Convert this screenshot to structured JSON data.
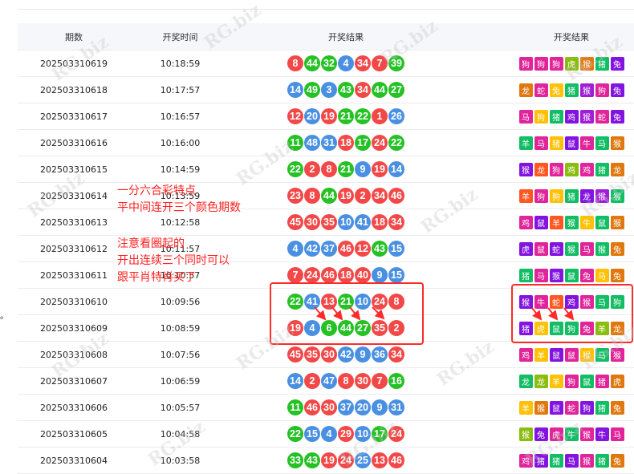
{
  "header": {
    "col1": "期数",
    "col2": "开奖时间",
    "col3": "开奖结果",
    "col4": "开奖结果"
  },
  "colors": {
    "red": "#f24848",
    "blue": "#4a90e2",
    "green": "#25c125",
    "box": "#ff2a2a",
    "note": "#ff1f1f"
  },
  "rows": [
    {
      "period": "202503310619",
      "time": "10:18:59",
      "nums": [
        "8",
        "44",
        "32",
        "4",
        "34",
        "7",
        "39"
      ],
      "ncol": [
        "r",
        "g",
        "g",
        "b",
        "r",
        "r",
        "g"
      ],
      "zodiac": [
        "狗",
        "狗",
        "狗",
        "虎",
        "猴",
        "猪",
        "兔"
      ],
      "zcol": [
        "#e0249a",
        "#e0249a",
        "#e0249a",
        "#8bbd10",
        "#e07810",
        "#12bd64",
        "#8314df"
      ]
    },
    {
      "period": "202503310618",
      "time": "10:17:57",
      "nums": [
        "14",
        "49",
        "3",
        "43",
        "34",
        "44",
        "27"
      ],
      "ncol": [
        "b",
        "g",
        "b",
        "g",
        "r",
        "g",
        "g"
      ],
      "zodiac": [
        "龙",
        "蛇",
        "兔",
        "猪",
        "猴",
        "狗",
        "兔"
      ],
      "zcol": [
        "#e07810",
        "#e0249a",
        "#ffc107",
        "#12bd64",
        "#9f1ed6",
        "#e0249a",
        "#8314df"
      ]
    },
    {
      "period": "202503310617",
      "time": "10:16:57",
      "nums": [
        "12",
        "20",
        "19",
        "21",
        "22",
        "1",
        "26"
      ],
      "ncol": [
        "r",
        "b",
        "r",
        "g",
        "g",
        "r",
        "b"
      ],
      "zodiac": [
        "马",
        "狗",
        "猪",
        "鸡",
        "猴",
        "蛇",
        "兔"
      ],
      "zcol": [
        "#e0249a",
        "#ffc107",
        "#12bd64",
        "#8314df",
        "#9f1ed6",
        "#e0249a",
        "#8314df"
      ]
    },
    {
      "period": "202503310616",
      "time": "10:16:00",
      "nums": [
        "11",
        "48",
        "31",
        "18",
        "17",
        "24",
        "22"
      ],
      "ncol": [
        "g",
        "b",
        "b",
        "r",
        "g",
        "r",
        "g"
      ],
      "zodiac": [
        "羊",
        "马",
        "猪",
        "鼠",
        "牛",
        "马",
        "猴"
      ],
      "zcol": [
        "#12bd64",
        "#e0249a",
        "#ffc107",
        "#8314df",
        "#e0249a",
        "#12bd64",
        "#e07810"
      ]
    },
    {
      "period": "202503310615",
      "time": "10:14:59",
      "nums": [
        "22",
        "2",
        "8",
        "21",
        "9",
        "19",
        "14"
      ],
      "ncol": [
        "g",
        "r",
        "r",
        "g",
        "b",
        "r",
        "b"
      ],
      "zodiac": [
        "猴",
        "龙",
        "狗",
        "鸡",
        "鸡",
        "猪",
        "龙"
      ],
      "zcol": [
        "#8314df",
        "#ff5722",
        "#e0249a",
        "#8bbd10",
        "#e0249a",
        "#12bd64",
        "#e07810"
      ]
    },
    {
      "period": "202503310614",
      "time": "10:13:59",
      "nums": [
        "23",
        "8",
        "44",
        "19",
        "2",
        "34",
        "46"
      ],
      "ncol": [
        "r",
        "r",
        "g",
        "r",
        "r",
        "r",
        "r"
      ],
      "zodiac": [
        "羊",
        "狗",
        "狗",
        "猪",
        "龙",
        "猴",
        "猴"
      ],
      "zcol": [
        "#ff5722",
        "#e0249a",
        "#ffc107",
        "#12bd64",
        "#8314df",
        "#9f1ed6",
        "#12bd64"
      ]
    },
    {
      "period": "202503310613",
      "time": "10:12:58",
      "nums": [
        "45",
        "30",
        "35",
        "10",
        "41",
        "18",
        "34"
      ],
      "ncol": [
        "r",
        "r",
        "r",
        "b",
        "b",
        "r",
        "r"
      ],
      "zodiac": [
        "鸡",
        "鼠",
        "羊",
        "猴",
        "牛",
        "鼠",
        "猴"
      ],
      "zcol": [
        "#e0249a",
        "#8314df",
        "#ff5722",
        "#12bd64",
        "#ffc107",
        "#12bd64",
        "#e07810"
      ]
    },
    {
      "period": "202503310612",
      "time": "10:11:57",
      "nums": [
        "4",
        "42",
        "37",
        "46",
        "12",
        "43",
        "15"
      ],
      "ncol": [
        "b",
        "b",
        "b",
        "r",
        "r",
        "g",
        "b"
      ],
      "zodiac": [
        "虎",
        "鼠",
        "蛇",
        "猴",
        "马",
        "猴",
        "兔"
      ],
      "zcol": [
        "#8314df",
        "#e0249a",
        "#8314df",
        "#12bd64",
        "#e0249a",
        "#12bd64",
        "#e07810"
      ]
    },
    {
      "period": "202503310611",
      "time": "10:10:57",
      "nums": [
        "7",
        "24",
        "46",
        "18",
        "40",
        "9",
        "15"
      ],
      "ncol": [
        "r",
        "r",
        "r",
        "r",
        "r",
        "b",
        "b"
      ],
      "zodiac": [
        "猪",
        "马",
        "猴",
        "鼠",
        "兔",
        "马",
        "兔"
      ],
      "zcol": [
        "#12bd64",
        "#e0249a",
        "#8314df",
        "#12bd64",
        "#e0249a",
        "#ffc107",
        "#e07810"
      ]
    },
    {
      "period": "202503310610",
      "time": "10:09:56",
      "nums": [
        "22",
        "41",
        "13",
        "21",
        "10",
        "24",
        "8"
      ],
      "ncol": [
        "g",
        "b",
        "r",
        "g",
        "b",
        "r",
        "r"
      ],
      "zodiac": [
        "猴",
        "牛",
        "蛇",
        "鸡",
        "猴",
        "马",
        "狗"
      ],
      "zcol": [
        "#8314df",
        "#e0249a",
        "#ff5722",
        "#8314df",
        "#e0249a",
        "#12bd64",
        "#12bd64"
      ]
    },
    {
      "period": "202503310609",
      "time": "10:08:59",
      "nums": [
        "19",
        "4",
        "6",
        "44",
        "27",
        "35",
        "2"
      ],
      "ncol": [
        "r",
        "b",
        "g",
        "g",
        "g",
        "r",
        "r"
      ],
      "zodiac": [
        "猪",
        "虎",
        "鼠",
        "狗",
        "兔",
        "羊",
        "龙"
      ],
      "zcol": [
        "#8314df",
        "#ffc107",
        "#12bd64",
        "#12bd64",
        "#e0249a",
        "#8bbd10",
        "#e07810"
      ]
    },
    {
      "period": "202503310608",
      "time": "10:07:56",
      "nums": [
        "45",
        "35",
        "30",
        "42",
        "9",
        "36",
        "34"
      ],
      "ncol": [
        "r",
        "r",
        "r",
        "b",
        "b",
        "b",
        "r"
      ],
      "zodiac": [
        "鸡",
        "羊",
        "鼠",
        "鼠",
        "猴",
        "马",
        "猴"
      ],
      "zcol": [
        "#e0249a",
        "#ffc107",
        "#8314df",
        "#e0249a",
        "#ffc107",
        "#12bd64",
        "#e0249a"
      ]
    },
    {
      "period": "202503310607",
      "time": "10:06:59",
      "nums": [
        "14",
        "2",
        "47",
        "8",
        "30",
        "7",
        "16"
      ],
      "ncol": [
        "b",
        "r",
        "b",
        "r",
        "r",
        "r",
        "g"
      ],
      "zodiac": [
        "龙",
        "龙",
        "羊",
        "狗",
        "鼠",
        "猪",
        "虎"
      ],
      "zcol": [
        "#12bd64",
        "#8bbd10",
        "#ffc107",
        "#e0249a",
        "#12bd64",
        "#e0249a",
        "#e07810"
      ]
    },
    {
      "period": "202503310606",
      "time": "10:05:57",
      "nums": [
        "11",
        "46",
        "30",
        "37",
        "20",
        "9",
        "31"
      ],
      "ncol": [
        "g",
        "r",
        "r",
        "b",
        "b",
        "b",
        "b"
      ],
      "zodiac": [
        "羊",
        "猴",
        "鼠",
        "蛇",
        "狗",
        "猪",
        "兔"
      ],
      "zcol": [
        "#ffc107",
        "#e07810",
        "#8314df",
        "#e0249a",
        "#8314df",
        "#12bd64",
        "#e07810"
      ]
    },
    {
      "period": "202503310605",
      "time": "10:04:58",
      "nums": [
        "22",
        "15",
        "4",
        "29",
        "10",
        "17",
        "24"
      ],
      "ncol": [
        "g",
        "b",
        "b",
        "r",
        "b",
        "g",
        "r"
      ],
      "zodiac": [
        "猴",
        "兔",
        "虎",
        "牛",
        "猴",
        "牛",
        "马"
      ],
      "zcol": [
        "#8bbd10",
        "#8314df",
        "#e0249a",
        "#12bd64",
        "#e0249a",
        "#8314df",
        "#e0249a"
      ]
    },
    {
      "period": "202503310604",
      "time": "10:03:58",
      "nums": [
        "33",
        "43",
        "19",
        "24",
        "25",
        "13",
        "46"
      ],
      "ncol": [
        "g",
        "g",
        "r",
        "r",
        "b",
        "r",
        "r"
      ],
      "zodiac": [
        "鸡",
        "猪",
        "猪",
        "马",
        "猴",
        "猪",
        "兔"
      ],
      "zcol": [
        "#e0249a",
        "#8314df",
        "#12bd64",
        "#8314df",
        "#e0249a",
        "#12bd64",
        "#e07810"
      ]
    }
  ],
  "notes": {
    "note1": "一分六合彩特点\n平中间连开三个颜色期数",
    "note2": "注意看圈起的\n开出连续三个同时可以\n跟平肖特肖买了"
  },
  "edge_glyph": "。",
  "watermark": "RG.biz"
}
